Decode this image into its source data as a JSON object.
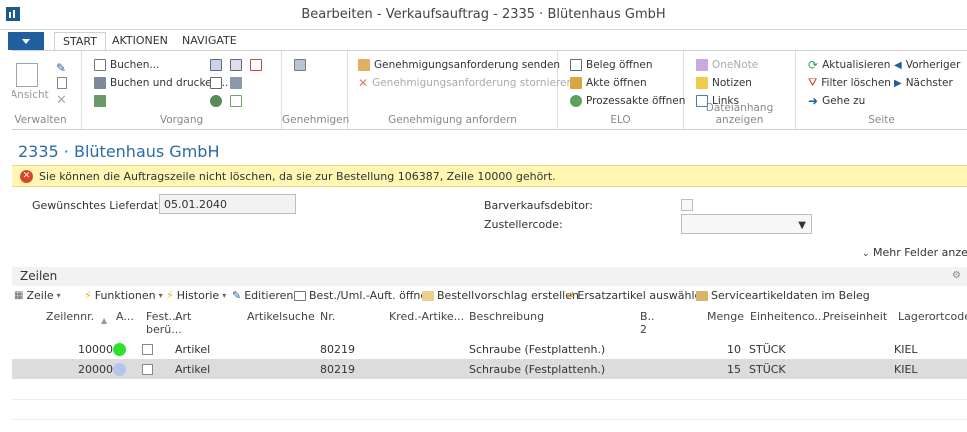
{
  "window": {
    "title": "Bearbeiten - Verkaufsauftrag - 2335 · Blütenhaus GmbH"
  },
  "tabs": [
    {
      "label": "START",
      "active": true
    },
    {
      "label": "AKTIONEN",
      "active": false
    },
    {
      "label": "NAVIGATE",
      "active": false
    }
  ],
  "ribbon": {
    "groups": {
      "verwalten": "Verwalten",
      "vorgang": "Vorgang",
      "genehmigen": "Genehmigen",
      "genehmigung_anfordern": "Genehmigung anfordern",
      "elo": "ELO",
      "dateianhang": "Dateianhang anzeigen",
      "seite": "Seite"
    },
    "buttons": {
      "ansicht": "Ansicht",
      "buchen": "Buchen...",
      "buchen_drucken": "Buchen und drucken...",
      "genehmigung_senden": "Genehmigungsanforderung senden",
      "genehmigung_stornieren": "Genehmigungsanforderung stornieren",
      "beleg_oeffnen": "Beleg öffnen",
      "akte_oeffnen": "Akte öffnen",
      "prozessakte_oeffnen": "Prozessakte öffnen",
      "onenote": "OneNote",
      "notizen": "Notizen",
      "links": "Links",
      "aktualisieren": "Aktualisieren",
      "filter_loeschen": "Filter löschen",
      "gehe_zu": "Gehe zu",
      "vorheriger": "Vorheriger",
      "naechster": "Nächster"
    }
  },
  "page": {
    "title": "2335 · Blütenhaus GmbH",
    "notification": "Sie können die Auftragszeile nicht löschen, da sie zur Bestellung 106387, Zeile 10000 gehört."
  },
  "fields": {
    "lieferdatum_label": "Gewünschtes Lieferdatum:",
    "lieferdatum_value": "05.01.2040",
    "barverkauf_label": "Barverkaufsdebitor:",
    "zusteller_label": "Zustellercode:",
    "zusteller_value": "",
    "more_fields": "Mehr Felder anzeigen"
  },
  "lines": {
    "title": "Zeilen",
    "toolbar": {
      "zeile": "Zeile",
      "funktionen": "Funktionen",
      "historie": "Historie",
      "editieren": "Editieren",
      "best_oeffnen": "Best./Uml.-Auft. öffnen",
      "bestellvorschlag": "Bestellvorschlag erstellen",
      "ersatzartikel": "Ersatzartikel auswählen",
      "serviceartikel": "Serviceartikeldaten im Beleg"
    },
    "columns": {
      "zeilennr": "Zeilennr.",
      "a": "A...",
      "fest1": "Fest...",
      "fest2": "berü...",
      "art": "Art",
      "artikelsuche": "Artikelsuche",
      "nr": "Nr.",
      "kred": "Kred.-Artike...",
      "beschreibung": "Beschreibung",
      "b1": "B..",
      "b2": "2",
      "menge": "Menge",
      "einheit": "Einheitenco...",
      "preis": "Preiseinheit",
      "lagerort": "Lagerortcode"
    },
    "rows": [
      {
        "zeilennr": "10000",
        "status_color": "#2ee02e",
        "art": "Artikel",
        "nr": "80219",
        "beschreibung": "Schraube (Festplattenh.)",
        "menge": "10",
        "einheit": "STÜCK",
        "lagerort": "KIEL"
      },
      {
        "zeilennr": "20000",
        "status_color": "#b3c4ee",
        "art": "Artikel",
        "nr": "80219",
        "beschreibung": "Schraube (Festplattenh.)",
        "menge": "15",
        "einheit": "STÜCK",
        "lagerort": "KIEL"
      }
    ]
  }
}
